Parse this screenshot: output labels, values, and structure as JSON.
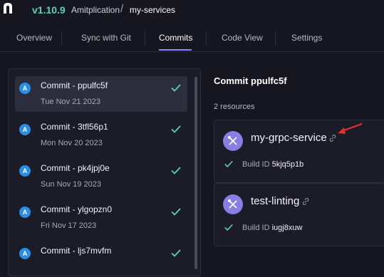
{
  "header": {
    "version": "v1.10.9",
    "breadcrumb": {
      "project": "Amitplication",
      "separator": "/",
      "service": "my-services"
    }
  },
  "tabs": [
    {
      "label": "Overview",
      "active": false
    },
    {
      "label": "Sync with Git",
      "active": false
    },
    {
      "label": "Commits",
      "active": true
    },
    {
      "label": "Code View",
      "active": false
    },
    {
      "label": "Settings",
      "active": false
    }
  ],
  "commits": [
    {
      "avatar": "A",
      "title": "Commit - ppulfc5f",
      "date": "Tue Nov 21 2023",
      "selected": true
    },
    {
      "avatar": "A",
      "title": "Commit - 3tfl56p1",
      "date": "Mon Nov 20 2023",
      "selected": false
    },
    {
      "avatar": "A",
      "title": "Commit - pk4jpj0e",
      "date": "Sun Nov 19 2023",
      "selected": false
    },
    {
      "avatar": "A",
      "title": "Commit - ylgopzn0",
      "date": "Fri Nov 17 2023",
      "selected": false
    },
    {
      "avatar": "A",
      "title": "Commit - ljs7mvfm",
      "date": "",
      "selected": false
    }
  ],
  "detail": {
    "title": "Commit ppulfc5f",
    "resource_count": "2 resources",
    "resources": [
      {
        "name": "my-grpc-service",
        "build_label": "Build ID",
        "build_id": "5kjq5p1b"
      },
      {
        "name": "test-linting",
        "build_label": "Build ID",
        "build_id": "iugj8xuw"
      }
    ]
  },
  "colors": {
    "accent": "#8f82ff",
    "check": "#5fd0b8",
    "avatar": "#2b8ee6",
    "resource_icon": "#8a7ee4",
    "annotation_arrow": "#e5312a"
  }
}
